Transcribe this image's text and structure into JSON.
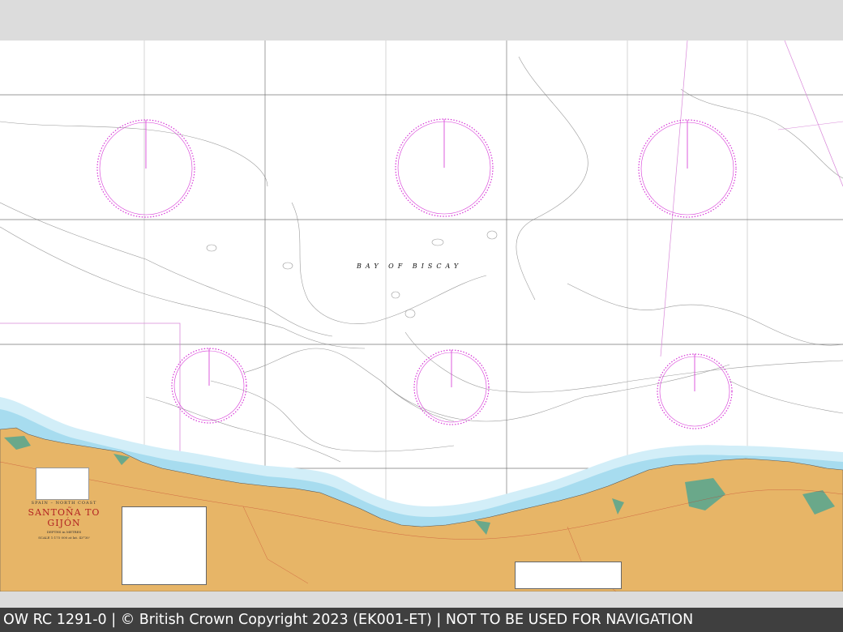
{
  "chart": {
    "sea_label": "BAY OF BISCAY",
    "region": "SPAIN – NORTH COAST",
    "title": "SANTOÑA TO GIJÓN",
    "depths": "DEPTHS in METRES",
    "scale": "SCALE 1:175 000 at lat. 43°30'"
  },
  "footer": {
    "text": "OW RC 1291-0 | © British Crown Copyright 2023 (EK001-ET) | NOT TO BE USED FOR NAVIGATION"
  },
  "colors": {
    "land": "#e7b567",
    "shallow": "#a7dcef",
    "shallow_light": "#d2eef8",
    "compass": "#d633d6",
    "grid": "#777777",
    "footer_bg": "#3f3f3f"
  }
}
